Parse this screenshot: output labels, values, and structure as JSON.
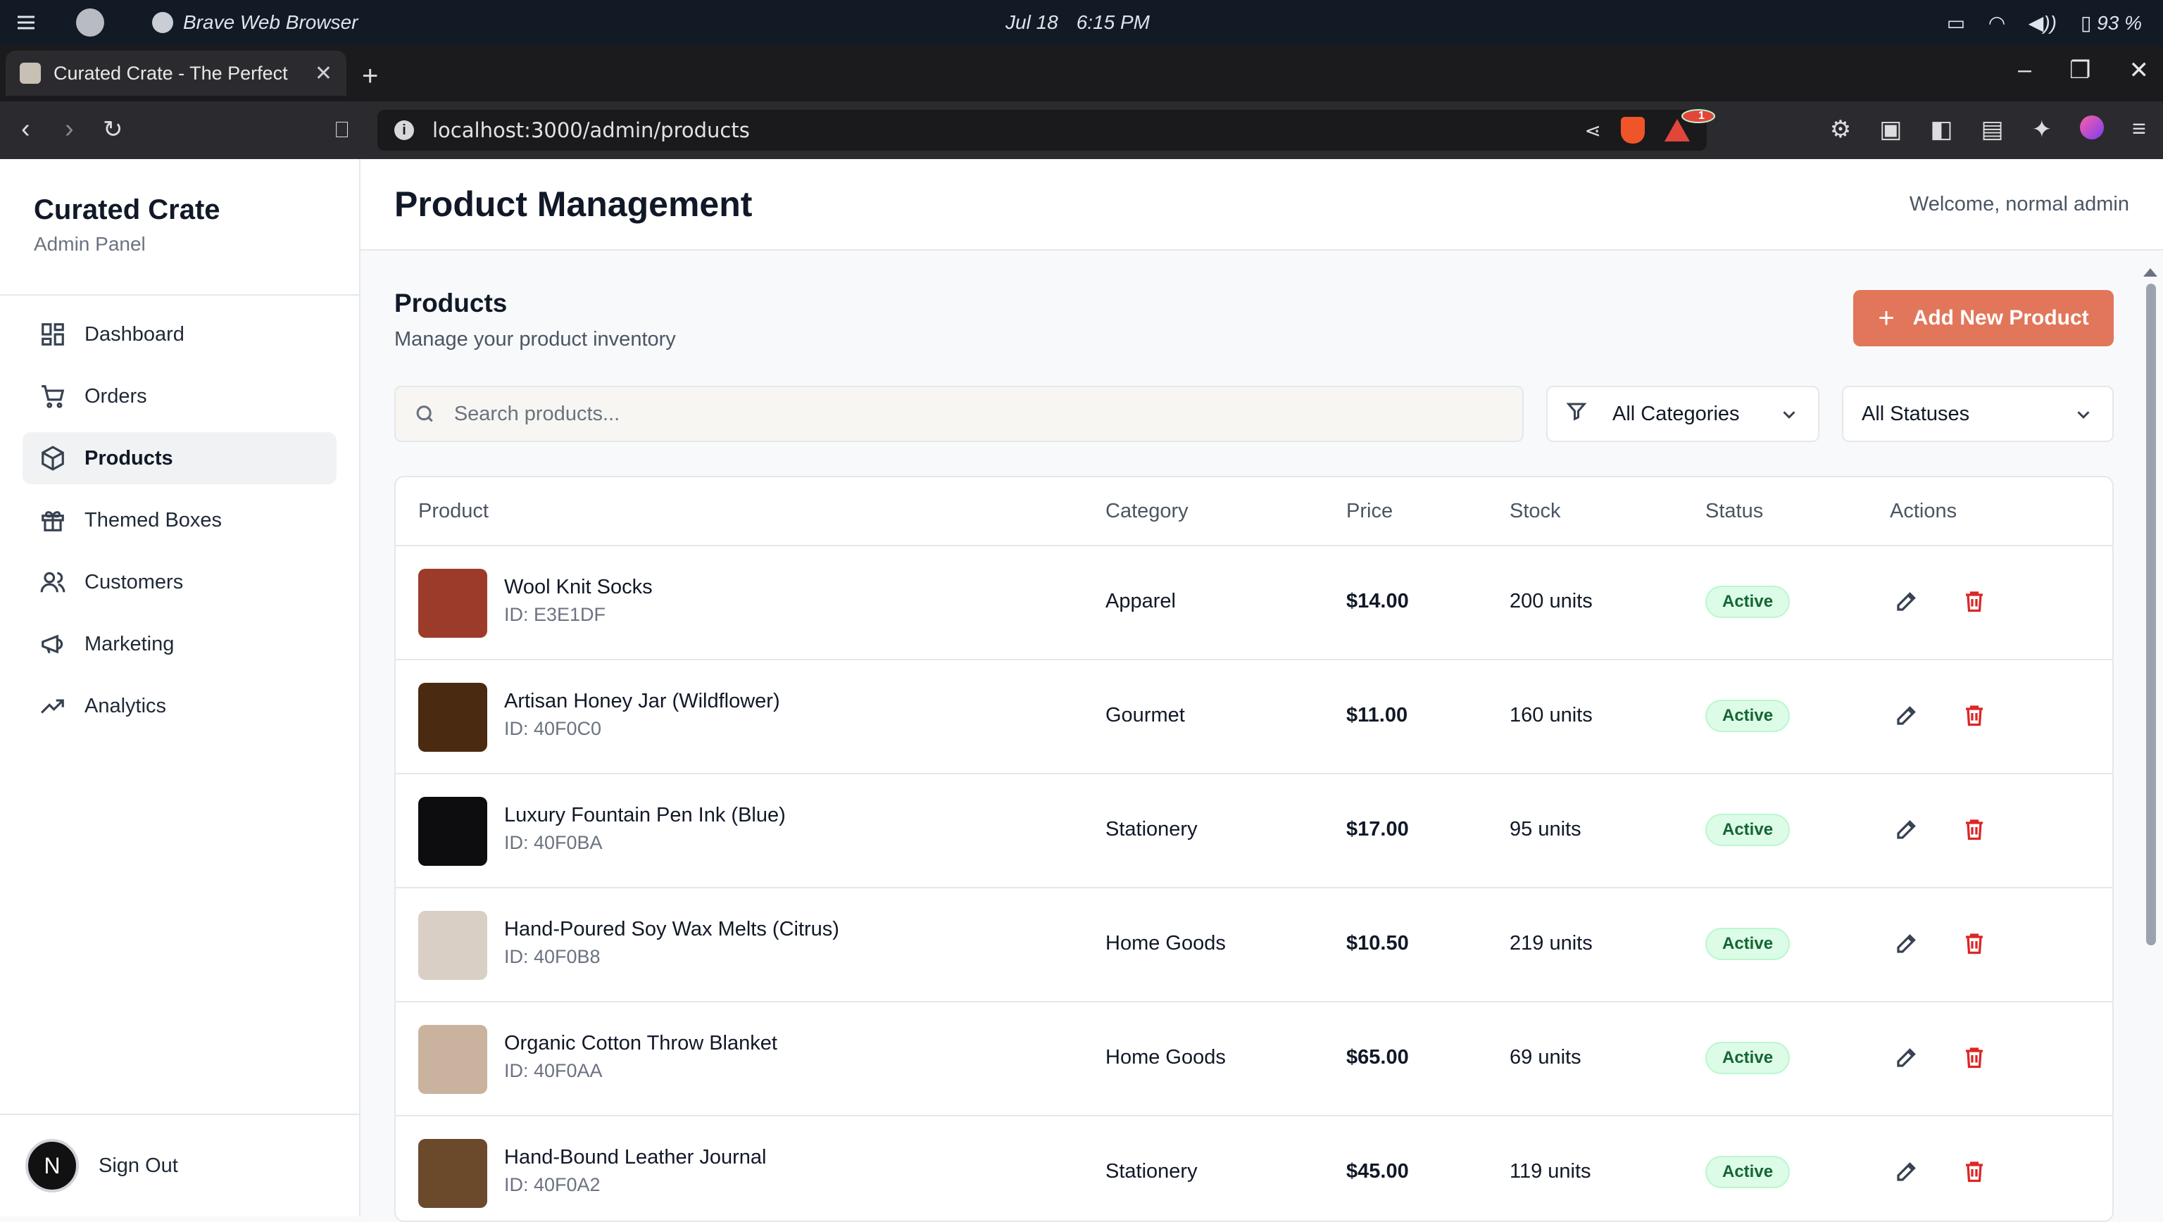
{
  "os": {
    "app_name": "Brave Web Browser",
    "date": "Jul 18",
    "time": "6:15 PM",
    "battery": "93 %"
  },
  "browser": {
    "tab_title": "Curated Crate - The Perfect",
    "url": "localhost:3000/admin/products",
    "shields_badge": "1"
  },
  "sidebar": {
    "brand": "Curated Crate",
    "subtitle": "Admin Panel",
    "items": [
      {
        "label": "Dashboard",
        "icon": "grid-icon"
      },
      {
        "label": "Orders",
        "icon": "cart-icon"
      },
      {
        "label": "Products",
        "icon": "box-icon",
        "active": true
      },
      {
        "label": "Themed Boxes",
        "icon": "gift-icon"
      },
      {
        "label": "Customers",
        "icon": "users-icon"
      },
      {
        "label": "Marketing",
        "icon": "megaphone-icon"
      },
      {
        "label": "Analytics",
        "icon": "trend-icon"
      }
    ],
    "avatar_letter": "N",
    "signout": "Sign Out"
  },
  "header": {
    "title": "Product Management",
    "welcome": "Welcome, normal admin"
  },
  "section": {
    "title": "Products",
    "subtitle": "Manage your product inventory",
    "add_button": "Add New Product"
  },
  "filters": {
    "search_placeholder": "Search products...",
    "category": "All Categories",
    "status": "All Statuses"
  },
  "table": {
    "headers": [
      "Product",
      "Category",
      "Price",
      "Stock",
      "Status",
      "Actions"
    ],
    "rows": [
      {
        "name": "Wool Knit Socks",
        "id": "ID: E3E1DF",
        "category": "Apparel",
        "price": "$14.00",
        "stock": "200 units",
        "status": "Active",
        "thumb_color": "#9c3b2a"
      },
      {
        "name": "Artisan Honey Jar (Wildflower)",
        "id": "ID: 40F0C0",
        "category": "Gourmet",
        "price": "$11.00",
        "stock": "160 units",
        "status": "Active",
        "thumb_color": "#4a2a10"
      },
      {
        "name": "Luxury Fountain Pen Ink (Blue)",
        "id": "ID: 40F0BA",
        "category": "Stationery",
        "price": "$17.00",
        "stock": "95 units",
        "status": "Active",
        "thumb_color": "#0d0d0f"
      },
      {
        "name": "Hand-Poured Soy Wax Melts (Citrus)",
        "id": "ID: 40F0B8",
        "category": "Home Goods",
        "price": "$10.50",
        "stock": "219 units",
        "status": "Active",
        "thumb_color": "#d9cfc4"
      },
      {
        "name": "Organic Cotton Throw Blanket",
        "id": "ID: 40F0AA",
        "category": "Home Goods",
        "price": "$65.00",
        "stock": "69 units",
        "status": "Active",
        "thumb_color": "#c9b39e"
      },
      {
        "name": "Hand-Bound Leather Journal",
        "id": "ID: 40F0A2",
        "category": "Stationery",
        "price": "$45.00",
        "stock": "119 units",
        "status": "Active",
        "thumb_color": "#6a4a2a"
      }
    ]
  },
  "colors": {
    "accent": "#e2765a",
    "status_active_bg": "#dcfce7",
    "status_active_text": "#166534",
    "delete": "#dc2626"
  }
}
